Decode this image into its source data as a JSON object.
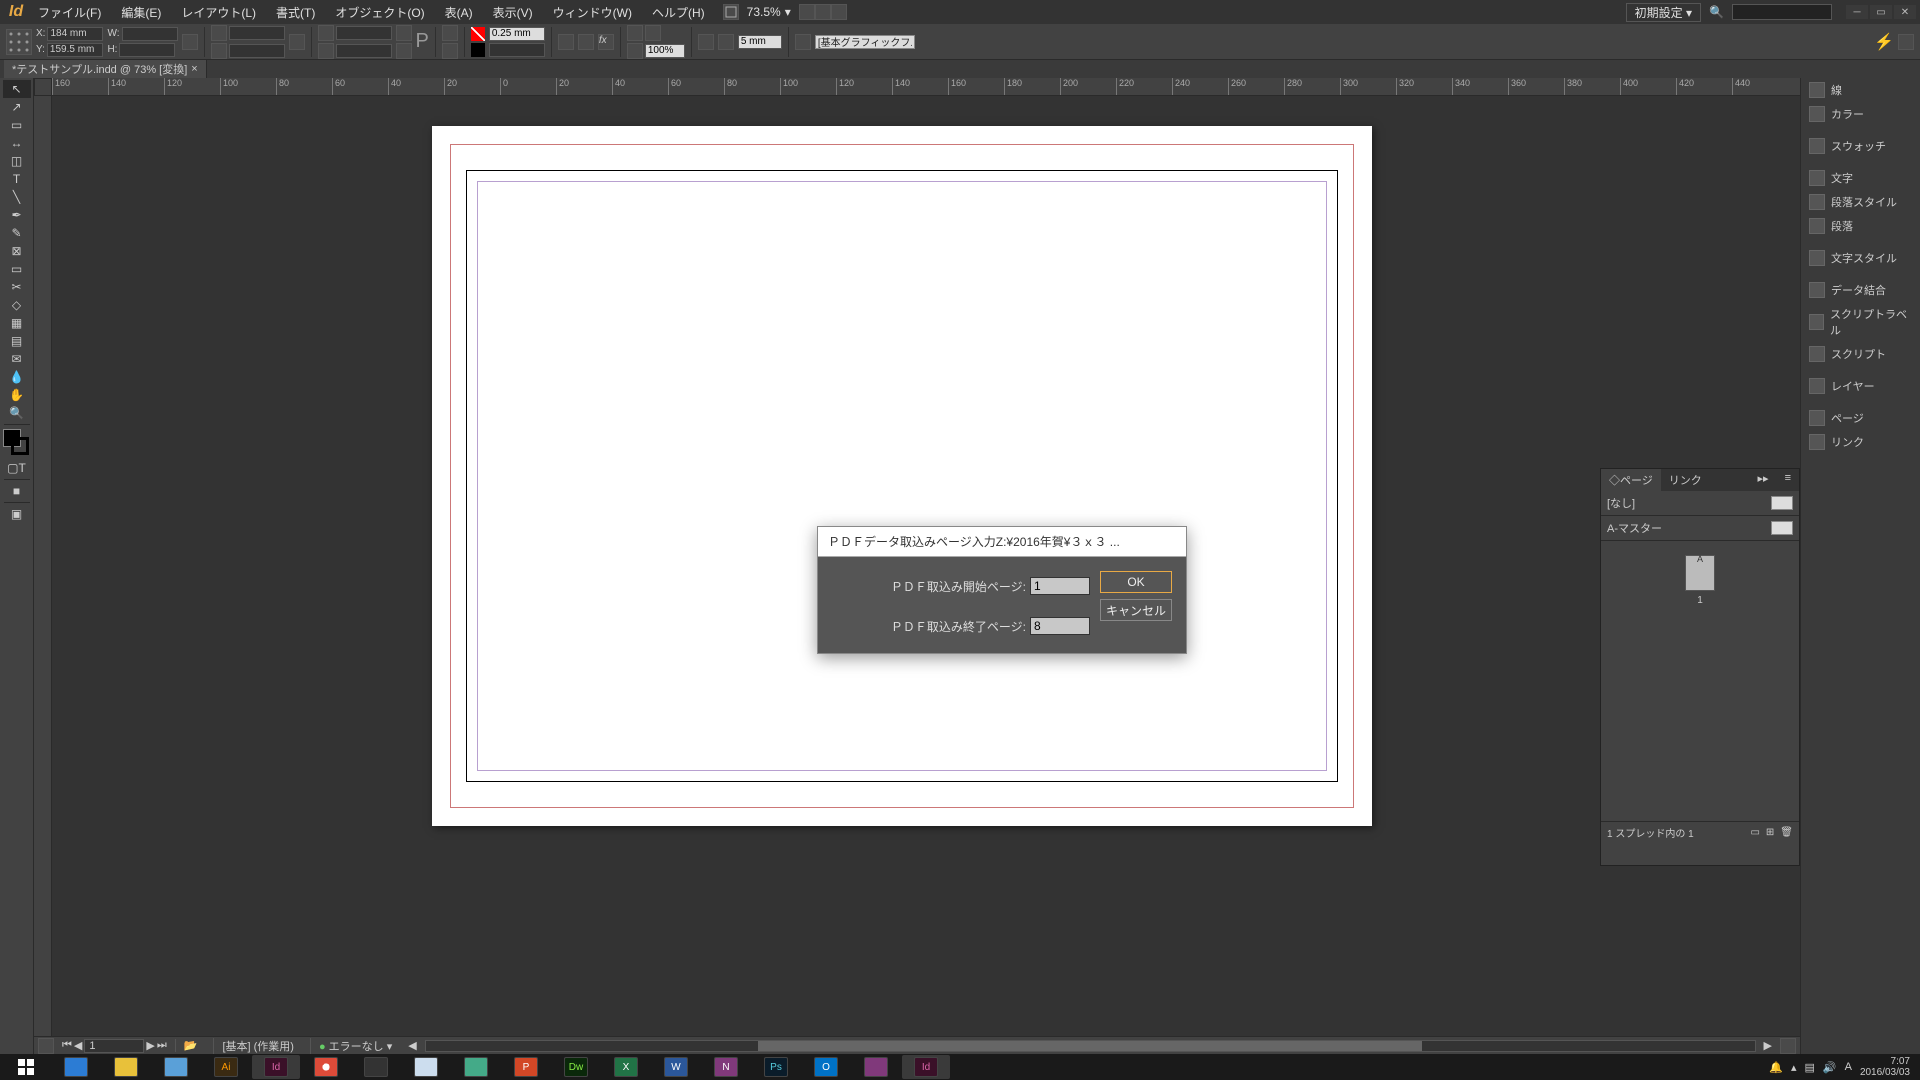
{
  "app": {
    "icon_letter": "Id"
  },
  "menu": {
    "file": "ファイル(F)",
    "edit": "編集(E)",
    "layout": "レイアウト(L)",
    "type": "書式(T)",
    "object": "オブジェクト(O)",
    "table": "表(A)",
    "view": "表示(V)",
    "window": "ウィンドウ(W)",
    "help": "ヘルプ(H)"
  },
  "zoom": {
    "value": "73.5%"
  },
  "workspace_menu": "初期設定",
  "controlbar": {
    "x": "184 mm",
    "y": "159.5 mm",
    "w": "",
    "h": "",
    "stroke": "0.25 mm",
    "fit": "5 mm",
    "opacity": "100%",
    "style_drop": "[基本グラフィックフ..."
  },
  "doc_tab": "*テストサンプル.indd @ 73% [変換]",
  "ruler_ticks": [
    "160",
    "140",
    "120",
    "100",
    "80",
    "60",
    "40",
    "20",
    "0",
    "20",
    "40",
    "60",
    "80",
    "100",
    "120",
    "140",
    "160",
    "180",
    "200",
    "220",
    "240",
    "260",
    "280",
    "300",
    "320",
    "340",
    "360",
    "380",
    "400",
    "420",
    "440"
  ],
  "dialog": {
    "title": "ＰＤＦデータ取込みページ入力Z:¥2016年賀¥３ｘ３ ...",
    "label_start": "ＰＤＦ取込み開始ページ:",
    "label_end": "ＰＤＦ取込み終了ページ:",
    "val_start": "1",
    "val_end": "8",
    "ok": "OK",
    "cancel": "キャンセル"
  },
  "right_panels": {
    "stroke": "線",
    "color": "カラー",
    "swatches": "スウォッチ",
    "char": "文字",
    "parastyle": "段落スタイル",
    "para": "段落",
    "charstyle": "文字スタイル",
    "datamerge": "データ結合",
    "scriptlabel": "スクリプトラベル",
    "script": "スクリプト",
    "layer": "レイヤー",
    "pages": "ページ",
    "links": "リンク"
  },
  "pages_panel": {
    "tab_pages": "ページ",
    "tab_links": "リンク",
    "none": "[なし]",
    "a_master": "A-マスター",
    "page1": "1",
    "footer": "1 スプレッド内の 1"
  },
  "status": {
    "page": "1",
    "layer": "[基本] (作業用)",
    "preflight": "エラーなし"
  },
  "tray": {
    "time": "7:07",
    "date": "2016/03/03"
  }
}
